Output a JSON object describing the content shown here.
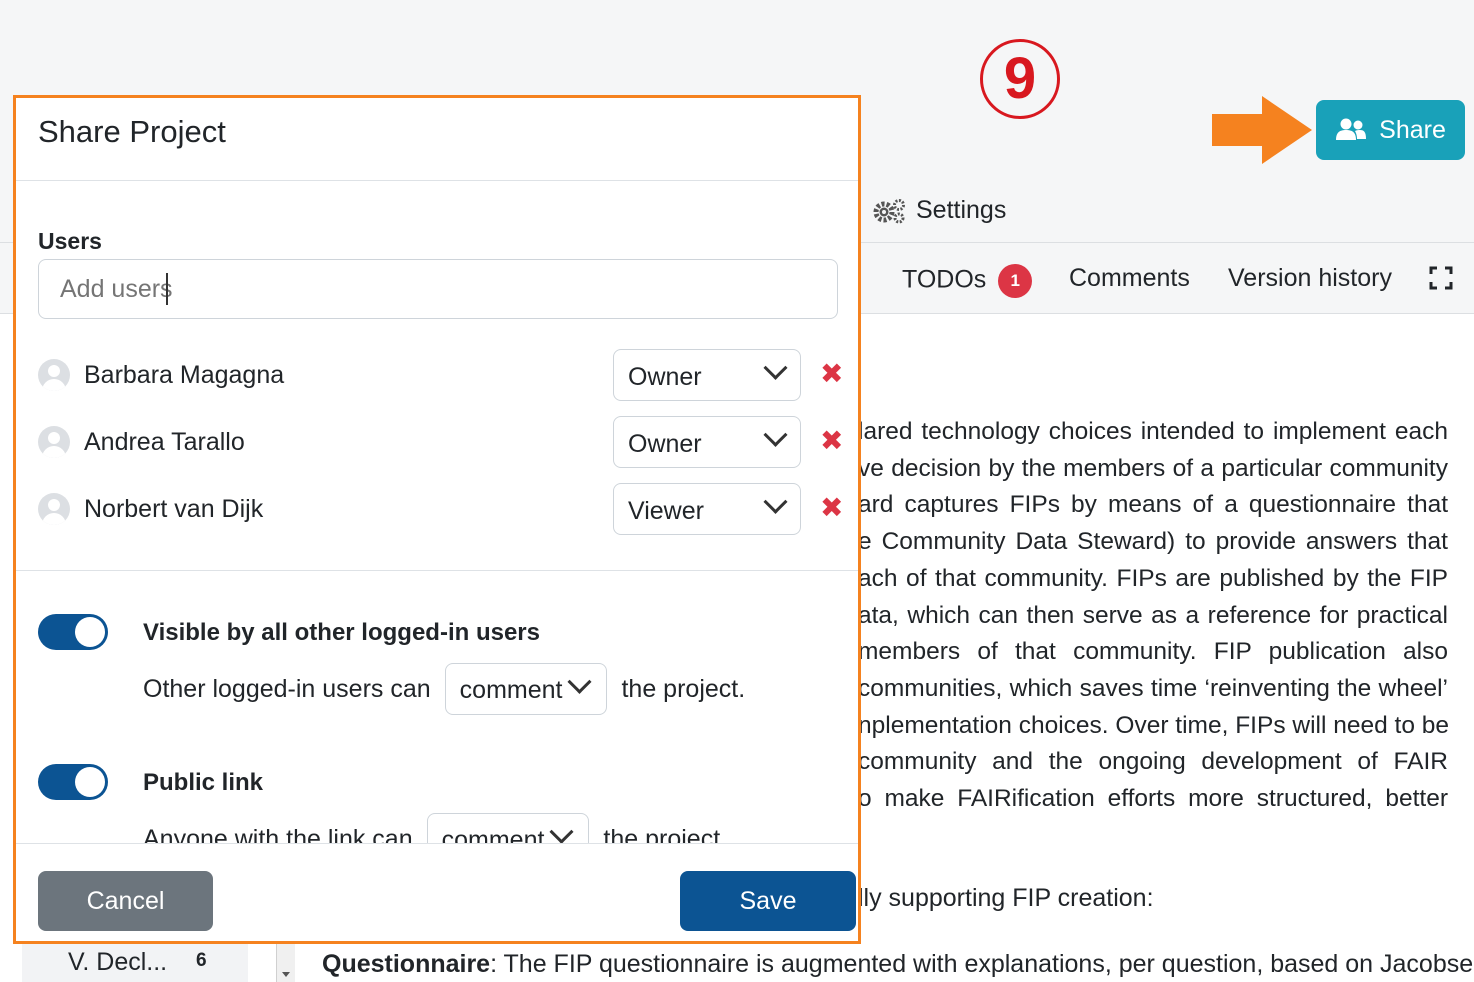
{
  "step_number": "9",
  "header": {
    "share_label": "Share",
    "settings_label": "Settings"
  },
  "tabs": {
    "todos_label": "TODOs",
    "todos_count": "1",
    "comments_label": "Comments",
    "version_history_label": "Version history"
  },
  "document": {
    "lines": [
      "lared technology choices intended to implement each",
      "ve decision by the members of a particular community",
      "ard captures FIPs by means of a questionnaire that",
      "e Community Data Steward) to provide answers that",
      "ach of that community. FIPs are published by the FIP",
      "ata, which can then serve as a reference for practical",
      " members of that community. FIP publication also",
      "communities, which saves time ‘reinventing the wheel’",
      "nplementation choices. Over time, FIPs will need to be",
      "community and the ongoing development of FAIR",
      "o make FAIRification efforts more structured, better"
    ],
    "support_line": "lly supporting FIP creation:",
    "questionnaire_bold": "Questionnaire",
    "questionnaire_rest": ": The FIP questionnaire is augmented with explanations, per question, based on Jacobsen"
  },
  "sidebar": {
    "item_label": "V.  Decl...",
    "item_count": "6"
  },
  "modal": {
    "title": "Share Project",
    "users_label": "Users",
    "add_users_placeholder": "Add users",
    "users": [
      {
        "name": "Barbara Magagna",
        "role": "Owner"
      },
      {
        "name": "Andrea Tarallo",
        "role": "Owner"
      },
      {
        "name": "Norbert van Dijk",
        "role": "Viewer"
      }
    ],
    "remove_glyph": "✖",
    "visible_title": "Visible by all other logged-in users",
    "visible_text_before": "Other logged-in users can",
    "visible_permission": "comment",
    "visible_text_after": "the project.",
    "public_title": "Public link",
    "public_text_before": "Anyone with the link can",
    "public_permission": "comment",
    "public_text_after": "the project.",
    "cancel_label": "Cancel",
    "save_label": "Save"
  },
  "colors": {
    "accent_share": "#19a1b9",
    "primary": "#0c5493",
    "danger": "#dc3545",
    "highlight_border": "#f5821f",
    "step_circle": "#d8181f"
  }
}
